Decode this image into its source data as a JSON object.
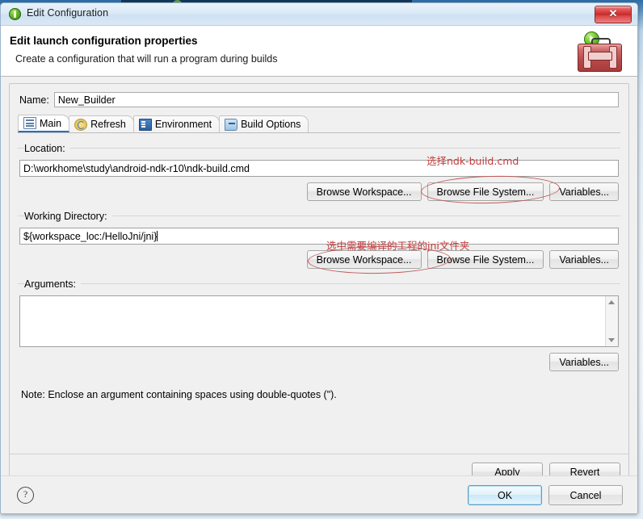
{
  "window": {
    "title": "Edit Configuration",
    "title_icon": "green-info-icon",
    "close_label": "✕"
  },
  "header": {
    "heading": "Edit launch configuration properties",
    "subheading": "Create a configuration that will run a program during builds",
    "icon": "toolbox-with-run-icon"
  },
  "form": {
    "name_label": "Name:",
    "name_value": "New_Builder"
  },
  "tabs": [
    {
      "label": "Main",
      "icon": "document-icon",
      "active": true
    },
    {
      "label": "Refresh",
      "icon": "refresh-icon",
      "active": false
    },
    {
      "label": "Environment",
      "icon": "environment-icon",
      "active": false
    },
    {
      "label": "Build Options",
      "icon": "build-options-icon",
      "active": false
    }
  ],
  "location": {
    "group_label": "Location:",
    "value": "D:\\workhome\\study\\android-ndk-r10\\ndk-build.cmd",
    "buttons": [
      "Browse Workspace...",
      "Browse File System...",
      "Variables..."
    ]
  },
  "working_directory": {
    "group_label": "Working Directory:",
    "value": "${workspace_loc:/HelloJni/jni}",
    "buttons": [
      "Browse Workspace...",
      "Browse File System...",
      "Variables..."
    ]
  },
  "arguments": {
    "group_label": "Arguments:",
    "value": "",
    "button": "Variables...",
    "note": "Note: Enclose an argument containing spaces using double-quotes (\")."
  },
  "panel_footer": {
    "apply": "Apply",
    "revert": "Revert"
  },
  "footer": {
    "help_icon": "question-mark-icon",
    "help_glyph": "?",
    "ok": "OK",
    "cancel": "Cancel"
  },
  "annotations": [
    {
      "text": "选择ndk-build.cmd",
      "target": "Browse File System..."
    },
    {
      "text": "选中需要编译的工程的jni文件夹",
      "target": "Browse Workspace..."
    }
  ],
  "colors": {
    "annotation_red": "#c53b3b",
    "accent_blue": "#2a6fbb",
    "dialog_bg": "#f0f0f0",
    "close_red": "#c62a2a"
  }
}
